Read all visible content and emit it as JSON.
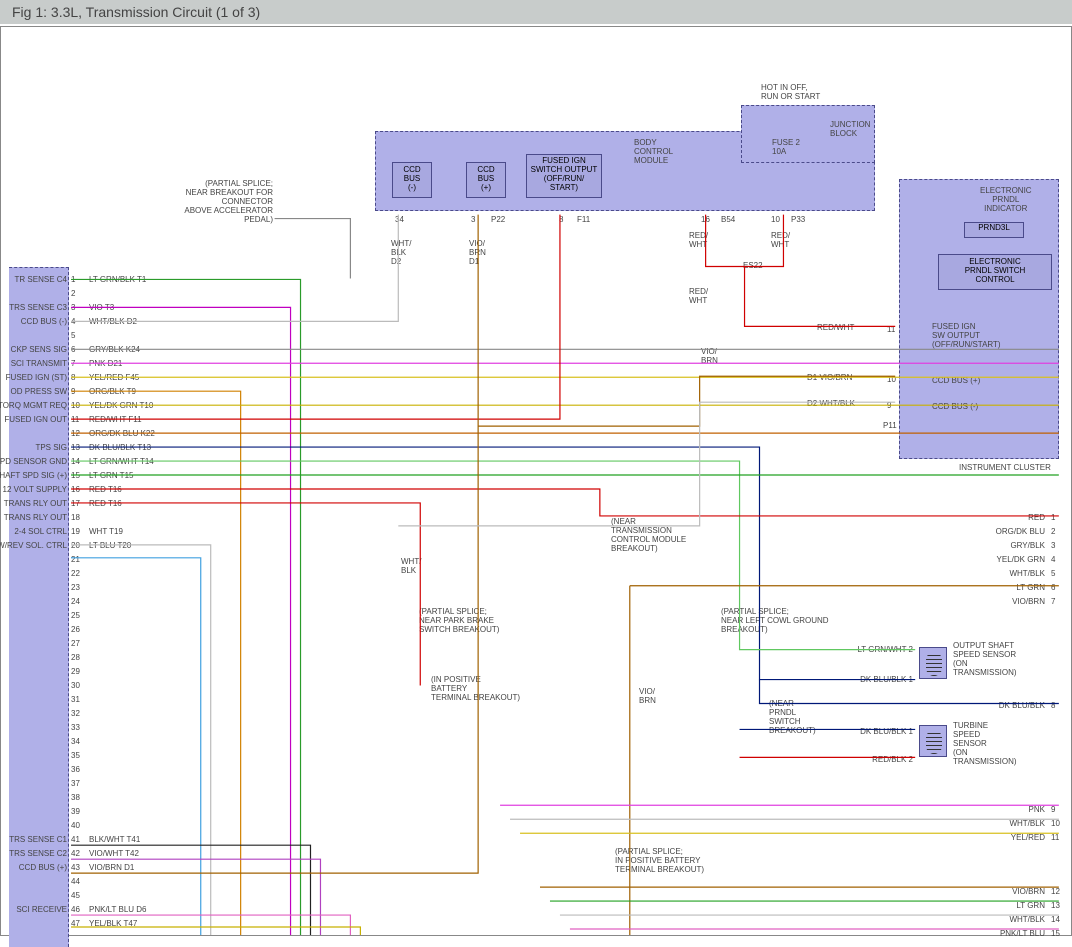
{
  "title": "Fig 1: 3.3L, Transmission Circuit (1 of 3)",
  "bcm": {
    "name": "BODY\nCONTROL\nMODULE",
    "ccd_neg": "CCD\nBUS\n(-)",
    "ccd_pos": "CCD\nBUS\n(+)",
    "fused_ign": "FUSED IGN\nSWITCH OUTPUT\n(OFF/RUN/\nSTART)",
    "pin34": "34",
    "pin3": "3",
    "pinP22": "P22",
    "pin8": "8",
    "pinF11": "F11",
    "pin16": "16",
    "pinB54": "B54",
    "pin10": "10",
    "pinP33": "P33"
  },
  "junction_block": {
    "name": "JUNCTION\nBLOCK",
    "hot": "HOT IN OFF,\nRUN OR START",
    "fuse": "FUSE 2\n10A"
  },
  "cluster": {
    "name": "INSTRUMENT CLUSTER",
    "prndl_ind": "ELECTRONIC\nPRNDL\nINDICATOR",
    "prndl_txt": "PRND3L",
    "prndl_sw": "ELECTRONIC\nPRNDL SWITCH\nCONTROL",
    "fused_ign": "FUSED IGN\nSW OUTPUT\n(OFF/RUN/START)",
    "ccd_pos": "CCD BUS (+)",
    "ccd_neg": "CCD BUS (-)",
    "pin11": "11",
    "pin10": "10",
    "pin9": "9",
    "pinP11": "P11"
  },
  "pcm_pins": [
    {
      "n": "1",
      "sig": "TR SENSE C4",
      "wire": "LT GRN/BLK",
      "code": "T1"
    },
    {
      "n": "2",
      "sig": "",
      "wire": "",
      "code": ""
    },
    {
      "n": "3",
      "sig": "TRS SENSE C3",
      "wire": "VIO",
      "code": "T3"
    },
    {
      "n": "4",
      "sig": "CCD BUS (-)",
      "wire": "WHT/BLK",
      "code": "D2"
    },
    {
      "n": "5",
      "sig": "",
      "wire": "",
      "code": ""
    },
    {
      "n": "6",
      "sig": "CKP SENS SIG",
      "wire": "GRY/BLK",
      "code": "K24"
    },
    {
      "n": "7",
      "sig": "SCI TRANSMIT",
      "wire": "PNK",
      "code": "D21"
    },
    {
      "n": "8",
      "sig": "FUSED IGN (ST)",
      "wire": "YEL/RED",
      "code": "F45"
    },
    {
      "n": "9",
      "sig": "OD PRESS SW",
      "wire": "ORG/BLK",
      "code": "T9"
    },
    {
      "n": "10",
      "sig": "TORQ MGMT REQ",
      "wire": "YEL/DK GRN",
      "code": "T10"
    },
    {
      "n": "11",
      "sig": "FUSED IGN OUT",
      "wire": "RED/WHT",
      "code": "F11"
    },
    {
      "n": "12",
      "sig": "",
      "wire": "ORG/DK BLU",
      "code": "K22"
    },
    {
      "n": "13",
      "sig": "TPS SIG",
      "wire": "DK BLU/BLK",
      "code": "T13"
    },
    {
      "n": "14",
      "sig": "SPD SENSOR GND",
      "wire": "LT GRN/WHT",
      "code": "T14"
    },
    {
      "n": "15",
      "sig": "SHAFT SPD SIG (+)",
      "wire": "LT GRN",
      "code": "T15"
    },
    {
      "n": "16",
      "sig": "12 VOLT SUPPLY",
      "wire": "RED",
      "code": "T16"
    },
    {
      "n": "17",
      "sig": "TRANS RLY OUT",
      "wire": "RED",
      "code": "T16"
    },
    {
      "n": "18",
      "sig": "TRANS RLY OUT",
      "wire": "",
      "code": ""
    },
    {
      "n": "19",
      "sig": "2-4 SOL CTRL",
      "wire": "WHT",
      "code": "T19"
    },
    {
      "n": "20",
      "sig": "LOW/REV SOL. CTRL",
      "wire": "LT BLU",
      "code": "T20"
    },
    {
      "n": "21",
      "sig": "",
      "wire": "",
      "code": ""
    },
    {
      "n": "22",
      "sig": "",
      "wire": "",
      "code": ""
    },
    {
      "n": "23",
      "sig": "",
      "wire": "",
      "code": ""
    },
    {
      "n": "24",
      "sig": "",
      "wire": "",
      "code": ""
    },
    {
      "n": "25",
      "sig": "",
      "wire": "",
      "code": ""
    },
    {
      "n": "26",
      "sig": "",
      "wire": "",
      "code": ""
    },
    {
      "n": "27",
      "sig": "",
      "wire": "",
      "code": ""
    },
    {
      "n": "28",
      "sig": "",
      "wire": "",
      "code": ""
    },
    {
      "n": "29",
      "sig": "",
      "wire": "",
      "code": ""
    },
    {
      "n": "30",
      "sig": "",
      "wire": "",
      "code": ""
    },
    {
      "n": "31",
      "sig": "",
      "wire": "",
      "code": ""
    },
    {
      "n": "32",
      "sig": "",
      "wire": "",
      "code": ""
    },
    {
      "n": "33",
      "sig": "",
      "wire": "",
      "code": ""
    },
    {
      "n": "34",
      "sig": "",
      "wire": "",
      "code": ""
    },
    {
      "n": "35",
      "sig": "",
      "wire": "",
      "code": ""
    },
    {
      "n": "36",
      "sig": "",
      "wire": "",
      "code": ""
    },
    {
      "n": "37",
      "sig": "",
      "wire": "",
      "code": ""
    },
    {
      "n": "38",
      "sig": "",
      "wire": "",
      "code": ""
    },
    {
      "n": "39",
      "sig": "",
      "wire": "",
      "code": ""
    },
    {
      "n": "40",
      "sig": "",
      "wire": "",
      "code": ""
    },
    {
      "n": "41",
      "sig": "TRS SENSE C1",
      "wire": "BLK/WHT",
      "code": "T41"
    },
    {
      "n": "42",
      "sig": "TRS SENSE C2",
      "wire": "VIO/WHT",
      "code": "T42"
    },
    {
      "n": "43",
      "sig": "CCD BUS (+)",
      "wire": "VIO/BRN",
      "code": "D1"
    },
    {
      "n": "44",
      "sig": "",
      "wire": "",
      "code": ""
    },
    {
      "n": "45",
      "sig": "",
      "wire": "",
      "code": ""
    },
    {
      "n": "46",
      "sig": "SCI RECEIVE",
      "wire": "PNK/LT BLU",
      "code": "D6"
    },
    {
      "n": "47",
      "sig": "",
      "wire": "YEL/BLK",
      "code": "T47"
    }
  ],
  "right_pins": [
    {
      "n": "1",
      "w": "RED"
    },
    {
      "n": "2",
      "w": "ORG/DK BLU"
    },
    {
      "n": "3",
      "w": "GRY/BLK"
    },
    {
      "n": "4",
      "w": "YEL/DK GRN"
    },
    {
      "n": "5",
      "w": "WHT/BLK"
    },
    {
      "n": "6",
      "w": "LT GRN"
    },
    {
      "n": "7",
      "w": "VIO/BRN"
    },
    {
      "n": "8",
      "w": "DK BLU/BLK"
    },
    {
      "n": "9",
      "w": "PNK"
    },
    {
      "n": "10",
      "w": "WHT/BLK"
    },
    {
      "n": "11",
      "w": "YEL/RED"
    },
    {
      "n": "12",
      "w": "VIO/BRN"
    },
    {
      "n": "13",
      "w": "LT GRN"
    },
    {
      "n": "14",
      "w": "WHT/BLK"
    },
    {
      "n": "15",
      "w": "PNK/LT BLU"
    }
  ],
  "sensors": {
    "output_shaft": "OUTPUT SHAFT\nSPEED SENSOR\n(ON\nTRANSMISSION)",
    "turbine": "TURBINE\nSPEED\nSENSOR\n(ON\nTRANSMISSION)",
    "lt_grn_wht_2": "LT GRN/WHT  2",
    "dk_blu_blk_1a": "DK BLU/BLK  1",
    "dk_blu_blk_1b": "DK BLU/BLK  1",
    "red_blk_2": "RED/BLK  2"
  },
  "notes": {
    "splice_accel": "(PARTIAL SPLICE;\nNEAR BREAKOUT FOR\nCONNECTOR\nABOVE ACCELERATOR\nPEDAL)",
    "near_tcm": "(NEAR\nTRANSMISSION\nCONTROL MODULE\nBREAKOUT)",
    "park_brake": "(PARTIAL SPLICE;\nNEAR PARK BRAKE\nSWITCH BREAKOUT)",
    "pos_batt": "(IN POSITIVE\nBATTERY\nTERMINAL BREAKOUT)",
    "cowl_gnd": "(PARTIAL SPLICE;\nNEAR LEFT COWL GROUND\nBREAKOUT)",
    "prndl_sw": "(NEAR\nPRNDL\nSWITCH\nBREAKOUT)",
    "pos_batt2": "(PARTIAL SPLICE;\nIN POSITIVE BATTERY\nTERMINAL BREAKOUT)"
  },
  "wire_labels": {
    "wht_blk_d2": "WHT/\nBLK\nD2",
    "vio_brn_d1": "VIO/\nBRN\nD1",
    "red_wht_a": "RED/\nWHT",
    "red_wht_b": "RED/\nWHT",
    "red_wht_c": "RED/\nWHT",
    "es22": "ES22",
    "vio_brn": "VIO/\nBRN",
    "wht_blk": "WHT/\nBLK",
    "d1_vio_brn": "D1   VIO/BRN",
    "d2_wht_blk": "D2   WHT/BLK",
    "red_wht_11": "RED/WHT"
  }
}
